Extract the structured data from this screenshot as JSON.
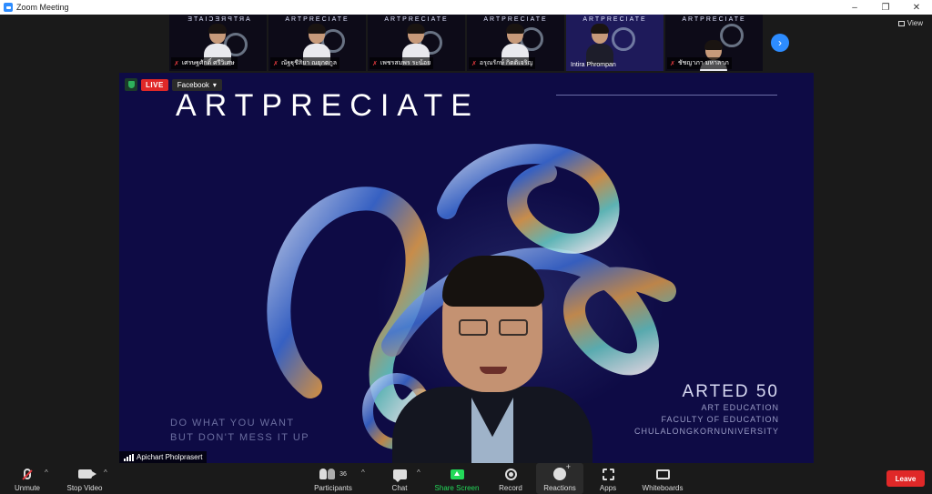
{
  "window": {
    "title": "Zoom Meeting",
    "controls": {
      "minimize": "–",
      "restore": "❐",
      "close": "✕"
    }
  },
  "gallery": {
    "thumbs": [
      {
        "brand": "ARTPRECIATE",
        "name": "เศรษฐศักดิ์ ศรีวิเศษ",
        "muted": true
      },
      {
        "brand": "ARTPRECIATE",
        "name": "ณัฐฐุชีสิยา ณยุกตกูล",
        "muted": true
      },
      {
        "brand": "ARTPRECIATE",
        "name": "เพชรสมพร ระน้อย",
        "muted": true
      },
      {
        "brand": "ARTPRECIATE",
        "name": "อรุณรักษ์ กิตติเจริญ",
        "muted": true
      },
      {
        "brand": "ARTPRECIATE",
        "name": "Intira Phrompan",
        "muted": false
      },
      {
        "brand": "ARTPRECIATE",
        "name": "ชัชญาภา มหาลาภ",
        "muted": true
      }
    ],
    "next_icon": "›",
    "view_label": "View"
  },
  "share": {
    "badges": {
      "live": "LIVE",
      "platform": "Facebook"
    },
    "slide": {
      "title": "ARTPRECIATE",
      "tagline_1": "DO WHAT YOU WANT",
      "tagline_2": "BUT DON'T MESS IT UP",
      "arted_big": "ARTED 50",
      "arted_1": "ART EDUCATION",
      "arted_2": "FACULTY OF EDUCATION",
      "arted_3": "CHULALONGKORNUNIVERSITY"
    },
    "speaker_name": "Apichart Pholprasert"
  },
  "toolbar": {
    "unmute": "Unmute",
    "stop_video": "Stop Video",
    "participants": "Participants",
    "participants_count": "36",
    "chat": "Chat",
    "share_screen": "Share Screen",
    "record": "Record",
    "reactions": "Reactions",
    "apps": "Apps",
    "whiteboards": "Whiteboards",
    "leave": "Leave",
    "caret": "^"
  },
  "colors": {
    "accent": "#2d8cff",
    "share_green": "#23d959",
    "leave_red": "#e02828",
    "slide_bg": "#0e0b45"
  }
}
